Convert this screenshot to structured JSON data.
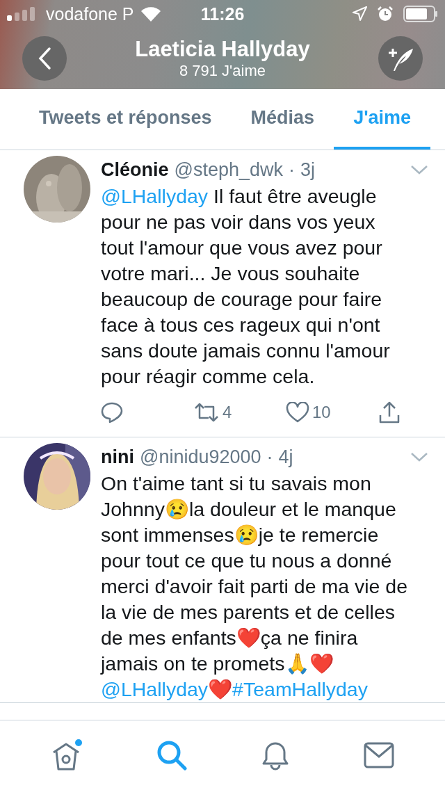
{
  "status_bar": {
    "carrier": "vodafone P",
    "time": "11:26"
  },
  "nav": {
    "title": "Laeticia Hallyday",
    "subtitle": "8 791 J'aime"
  },
  "tabs": [
    {
      "label": "Tweets et réponses",
      "selected": false
    },
    {
      "label": "Médias",
      "selected": false
    },
    {
      "label": "J'aime",
      "selected": true
    }
  ],
  "tweets": [
    {
      "avatar": {
        "kind": "picture"
      },
      "name": "Cléonie",
      "handle": "@steph_dwk",
      "dot": "·",
      "time": "3j",
      "text": [
        {
          "kind": "mention",
          "text": "@LHallyday"
        },
        {
          "kind": "text",
          "text": " Il faut être aveugle pour ne pas voir dans vos yeux tout l'amour que vous avez pour votre mari... Je vous souhaite beaucoup de courage pour faire face à tous ces rageux qui n'ont sans doute jamais connu l'amour pour réagir comme cela."
        }
      ],
      "actions": {
        "retweets": "4",
        "likes": "10"
      }
    },
    {
      "avatar": {
        "kind": "picture"
      },
      "name": "nini",
      "handle": "@ninidu92000",
      "dot": "·",
      "time": "4j",
      "text": [
        {
          "kind": "text",
          "text": "On t'aime tant si tu savais mon Johnny😢la douleur et le manque sont immenses😢je te remercie pour tout ce que tu nous a donné merci d'avoir fait parti de ma vie de la vie de mes parents et de celles de mes enfants❤️ça ne finira jamais on te promets🙏❤️ "
        },
        {
          "kind": "mention",
          "text": "@LHallyday"
        },
        {
          "kind": "text",
          "text": "❤️"
        },
        {
          "kind": "hashtag",
          "text": "#TeamHallyday"
        }
      ]
    }
  ],
  "tab_bar": [
    {
      "kind": "home",
      "selected": false,
      "notification": true
    },
    {
      "kind": "search",
      "selected": true
    },
    {
      "kind": "notifications",
      "selected": false
    },
    {
      "kind": "messages",
      "selected": false
    }
  ]
}
